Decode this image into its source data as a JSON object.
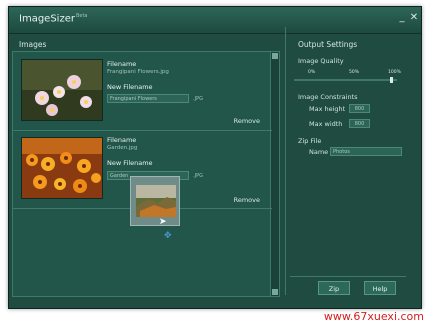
{
  "window": {
    "title": "ImageSizer",
    "title_sup": "Beta",
    "minimize": "_",
    "close": "✕"
  },
  "images_pane": {
    "title": "Images"
  },
  "items": [
    {
      "filename_label": "Filename",
      "filename": "Frangipani Flowers.jpg",
      "new_filename_label": "New Filename",
      "new_filename": "Frangipani Flowers",
      "extension": ".JPG",
      "remove": "Remove"
    },
    {
      "filename_label": "Filename",
      "filename": "Garden.jpg",
      "new_filename_label": "New Filename",
      "new_filename": "Garden",
      "extension": ".JPG",
      "remove": "Remove"
    }
  ],
  "output": {
    "title": "Output Settings",
    "quality_label": "Image Quality",
    "quality_ticks": [
      "0%",
      "50%",
      "100%"
    ],
    "quality_value": 0.95,
    "constraints_label": "Image Constraints",
    "max_height_label": "Max height",
    "max_height": "800",
    "max_width_label": "Max width",
    "max_width": "800",
    "zip_label": "Zip File",
    "name_label": "Name",
    "name_value": "Photos"
  },
  "buttons": {
    "zip": "Zip",
    "help": "Help"
  },
  "watermark": "www.67xuexi.com",
  "colors": {
    "background": "#1f4b40",
    "accent": "#2d6958",
    "watermark": "#d31e1e"
  }
}
